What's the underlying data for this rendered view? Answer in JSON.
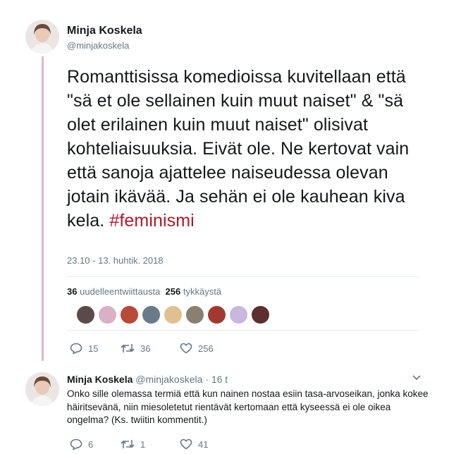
{
  "tweet": {
    "author_name": "Minja Koskela",
    "author_handle": "@minjakoskela",
    "text": "Romanttisissa komedioissa kuvitellaan että \"sä et ole sellainen kuin muut naiset\" & \"sä olet erilainen kuin muut naiset\" olisivat kohteliaisuuksia. Eivät ole. Ne kertovat vain että sanoja ajattelee naiseudessa olevan jotain ikävää. Ja sehän ei ole kauhean kiva kela.",
    "hashtag": "#feminismi",
    "timestamp": "23.10 - 13. huhtik. 2018",
    "retweets_count": "36",
    "retweets_label": "uudelleentwiittausta",
    "likes_count": "256",
    "likes_label": "tykkäystä",
    "actions": {
      "reply_count": "15",
      "retweet_count": "36",
      "like_count": "256"
    }
  },
  "likers": [
    {
      "icon": "liker-avatar-1",
      "color": "#5a4a4a"
    },
    {
      "icon": "liker-avatar-2",
      "color": "#d8b0c8"
    },
    {
      "icon": "liker-avatar-3",
      "color": "#b84a3a"
    },
    {
      "icon": "liker-avatar-4",
      "color": "#6a7a8a"
    },
    {
      "icon": "liker-avatar-5",
      "color": "#e0c090"
    },
    {
      "icon": "liker-avatar-6",
      "color": "#8a8070"
    },
    {
      "icon": "liker-avatar-7",
      "color": "#a03a30"
    },
    {
      "icon": "liker-avatar-8",
      "color": "#c8b8e0"
    },
    {
      "icon": "liker-avatar-9",
      "color": "#5a3030"
    }
  ],
  "reply": {
    "author_name": "Minja Koskela",
    "author_handle": "@minjakoskela",
    "time": "· 16 t",
    "text": "Onko sille olemassa termiä että kun nainen nostaa esiin tasa-arvoseikan, jonka kokee häiritsevänä, niin miesoletetut rientävät kertomaan että kyseessä ei ole oikea ongelma? (Ks. twiitin kommentit.)",
    "actions": {
      "reply_count": "6",
      "retweet_count": "1",
      "like_count": "41"
    }
  },
  "colors": {
    "accent": "#b3162a",
    "thread_line": "#e0b9bf",
    "muted": "#657786"
  }
}
